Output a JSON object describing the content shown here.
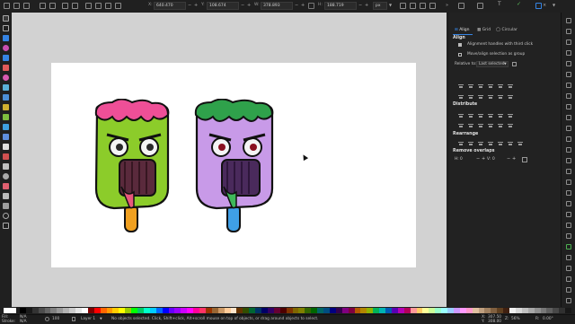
{
  "toolbar": {
    "x_label": "X:",
    "x_value": "640.470",
    "y_label": "Y:",
    "y_value": "108.674",
    "w_label": "W:",
    "w_value": "378.893",
    "h_label": "H:",
    "h_value": "188.719",
    "unit": "px"
  },
  "dock": {
    "tabs": [
      "Align",
      "Grid",
      "Circular"
    ],
    "align_heading": "Align",
    "opt_handles": "Alignment handles with third click",
    "opt_group": "Move/align selection as group",
    "relative_label": "Relative to:",
    "relative_value": "Last selected",
    "distribute_heading": "Distribute",
    "rearrange_heading": "Rearrange",
    "remove_overlaps_heading": "Remove overlaps",
    "h_label": "H:",
    "h_value": "0",
    "v_label": "V:",
    "v_value": "0"
  },
  "status": {
    "fill_label": "Fill:",
    "fill_value": "N/A",
    "stroke_label": "Stroke:",
    "stroke_value": "N/A",
    "opacity_value": "100",
    "layer": "Layer 1",
    "message": "No objects selected. Click, Shift+click, Alt+scroll mouse on top of objects, or drag around objects to select.",
    "x_label": "X:",
    "x_value": "307.50",
    "y_label": "Y:",
    "y_value": "308.00",
    "z_label": "Z:",
    "zoom": "56%",
    "r_label": "R:",
    "rotation": "0.00°"
  },
  "palette": [
    "#000000",
    "#1a1a1a",
    "#333333",
    "#4d4d4d",
    "#666666",
    "#808080",
    "#999999",
    "#b3b3b3",
    "#cccccc",
    "#e6e6e6",
    "#ffffff",
    "#800000",
    "#ff0000",
    "#ff6600",
    "#ff9900",
    "#ffcc00",
    "#ffff00",
    "#99cc00",
    "#00ff00",
    "#00cc66",
    "#00ffcc",
    "#00ccff",
    "#0066ff",
    "#0000ff",
    "#6600ff",
    "#9900ff",
    "#cc00ff",
    "#ff00ff",
    "#ff0099",
    "#ff3366",
    "#993300",
    "#996633",
    "#cc9966",
    "#ffcc99",
    "#ffe6cc",
    "#663300",
    "#334d00",
    "#006633",
    "#003366",
    "#000066",
    "#330066",
    "#660033",
    "#4d0000",
    "#803300",
    "#806600",
    "#808000",
    "#336600",
    "#006600",
    "#006666",
    "#004d80",
    "#000080",
    "#33004d",
    "#800080",
    "#800040",
    "#b35900",
    "#b38600",
    "#8fb300",
    "#00b359",
    "#00b3b3",
    "#0059b3",
    "#5900b3",
    "#b300b3",
    "#b30059",
    "#ff9999",
    "#ffcc66",
    "#ffff99",
    "#ccff99",
    "#99ffcc",
    "#99ffff",
    "#99ccff",
    "#cc99ff",
    "#ff99ff",
    "#ff99cc",
    "#e0c0a0",
    "#c0a080",
    "#a08060",
    "#806040",
    "#604020",
    "#402010",
    "#f0f0f0",
    "#d8d8d8",
    "#c0c0c0",
    "#a8a8a8",
    "#909090",
    "#787878",
    "#606060",
    "#484848",
    "#303030",
    "#181818"
  ],
  "colors": {
    "accent": "#3584e4",
    "canvas": "#d2d2d2",
    "page": "#ffffff",
    "slime_green": "#8ccc2a",
    "purple": "#c89ae8"
  }
}
